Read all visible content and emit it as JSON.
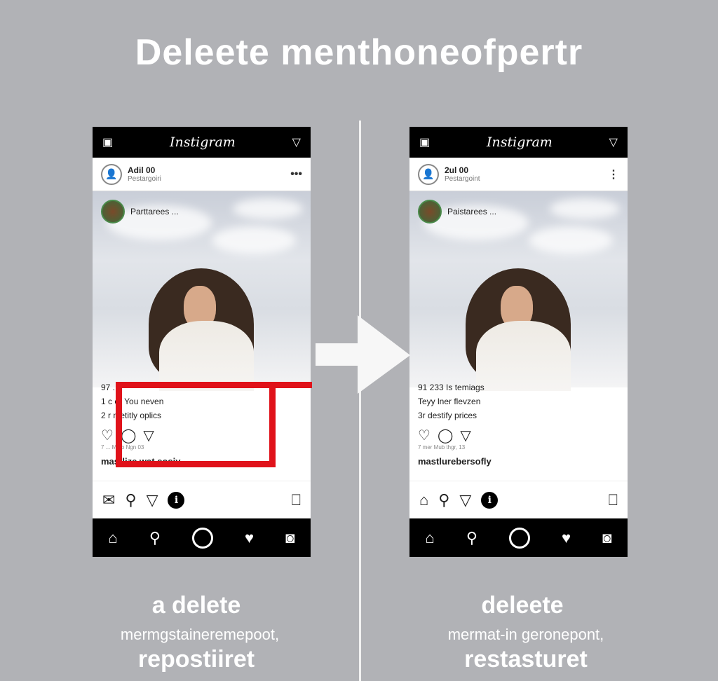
{
  "headline": "Deleete menthoneofpertr",
  "left": {
    "app_title": "Instigram",
    "user": "Adil 00",
    "user_sub": "Pestargoiri",
    "overlay_name": "Parttarees ...",
    "lines": [
      "97 ... ",
      "1 c er You neven",
      "2 r metitly oplics"
    ],
    "meta": "7 ... Mtab Ngn 03",
    "username": "mastlize wat sosiy",
    "caption": [
      "a delete",
      "mermgstaineremepoot,",
      "repostiiret"
    ]
  },
  "right": {
    "app_title": "Instigram",
    "user": "2ul 00",
    "user_sub": "Pestargoint",
    "overlay_name": "Paistarees ...",
    "lines": [
      "91 233 Is temiags",
      "Teyy lner flevzen",
      "3r destify prices"
    ],
    "meta": "7 mer Mub thgr, 13",
    "username": "mastlurebersofly",
    "caption": [
      "deleete",
      "mermat-in geronepont,",
      "restasturet"
    ]
  },
  "colors": {
    "highlight": "#e0121a",
    "background": "#b1b2b6"
  }
}
